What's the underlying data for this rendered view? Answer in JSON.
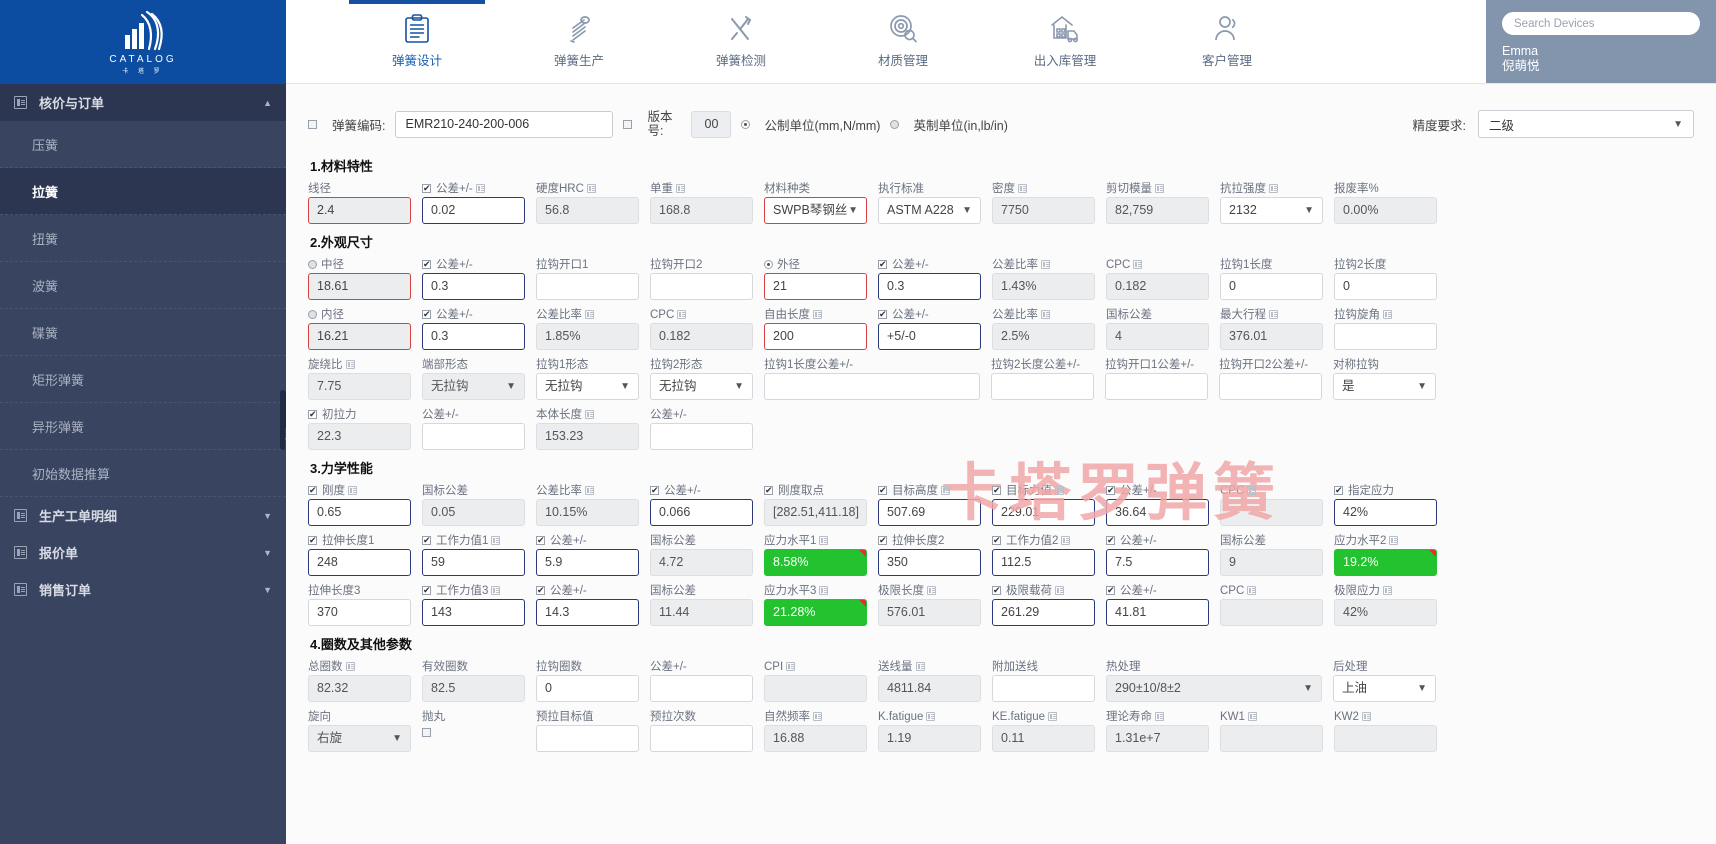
{
  "brand": {
    "name": "CATALOG",
    "sub": "卡 塔 罗"
  },
  "sidebar": {
    "groups": [
      {
        "label": "核价与订单",
        "expanded": true,
        "items": [
          "压簧",
          "拉簧",
          "扭簧",
          "波簧",
          "碟簧",
          "矩形弹簧",
          "异形弹簧",
          "初始数据推算"
        ],
        "active": "拉簧"
      },
      {
        "label": "生产工单明细",
        "expanded": false,
        "items": []
      },
      {
        "label": "报价单",
        "expanded": false,
        "items": []
      },
      {
        "label": "销售订单",
        "expanded": false,
        "items": []
      }
    ]
  },
  "topnav": {
    "tabs": [
      {
        "label": "弹簧设计",
        "icon": "clipboard-icon",
        "active": true
      },
      {
        "label": "弹簧生产",
        "icon": "spring-icon",
        "active": false
      },
      {
        "label": "弹簧检测",
        "icon": "tools-icon",
        "active": false
      },
      {
        "label": "材质管理",
        "icon": "target-search-icon",
        "active": false
      },
      {
        "label": "出入库管理",
        "icon": "warehouse-truck-icon",
        "active": false
      },
      {
        "label": "客户管理",
        "icon": "users-icon",
        "active": false
      }
    ],
    "search_placeholder": "Search Devices",
    "user": {
      "name_en": "Emma",
      "name_cn": "倪萌悦"
    }
  },
  "header": {
    "code_label": "弹簧编码:",
    "code_value": "EMR210-240-200-006",
    "version_label": "版本号:",
    "version_value": "00",
    "unit_metric": "公制单位(mm,N/mm)",
    "unit_imperial": "英制单位(in,lb/in)",
    "precision_label": "精度要求:",
    "precision_value": "二级"
  },
  "watermark": "卡塔罗弹簧",
  "sections": [
    {
      "title": "1.材料特性",
      "rows": [
        [
          {
            "label": "线径",
            "value": "2.4",
            "style": "red"
          },
          {
            "label": "公差+/-",
            "value": "0.02",
            "style": "blue",
            "checkbox": true,
            "mini": true
          },
          {
            "label": "硬度HRC",
            "value": "56.8",
            "style": "ro",
            "mini": true
          },
          {
            "label": "单重",
            "value": "168.8",
            "style": "ro",
            "mini": true
          },
          {
            "label": "材料种类",
            "value": "SWPB琴钢丝",
            "style": "redw",
            "select": true
          },
          {
            "label": "执行标准",
            "value": "ASTM A228",
            "style": "",
            "select": true
          },
          {
            "label": "密度",
            "value": "7750",
            "style": "ro",
            "mini": true
          },
          {
            "label": "剪切模量",
            "value": "82,759",
            "style": "ro",
            "mini": true
          },
          {
            "label": "抗拉强度",
            "value": "2132",
            "style": "",
            "select": true,
            "mini": true
          },
          {
            "label": "报废率%",
            "value": "0.00%",
            "style": "ro"
          }
        ]
      ]
    },
    {
      "title": "2.外观尺寸",
      "rows": [
        [
          {
            "label": "中径",
            "value": "18.61",
            "style": "red",
            "radio": true
          },
          {
            "label": "公差+/-",
            "value": "0.3",
            "style": "blue",
            "checkbox": true
          },
          {
            "label": "拉钩开口1",
            "value": "",
            "style": ""
          },
          {
            "label": "拉钩开口2",
            "value": "",
            "style": ""
          },
          {
            "label": "外径",
            "value": "21",
            "style": "redw",
            "radio": true,
            "radio_on": true
          },
          {
            "label": "公差+/-",
            "value": "0.3",
            "style": "blue",
            "checkbox": true
          },
          {
            "label": "公差比率",
            "value": "1.43%",
            "style": "ro",
            "mini": true
          },
          {
            "label": "CPC",
            "value": "0.182",
            "style": "ro",
            "mini": true
          },
          {
            "label": "拉钩1长度",
            "value": "0",
            "style": ""
          },
          {
            "label": "拉钩2长度",
            "value": "0",
            "style": ""
          }
        ],
        [
          {
            "label": "内径",
            "value": "16.21",
            "style": "red",
            "radio": true
          },
          {
            "label": "公差+/-",
            "value": "0.3",
            "style": "blue",
            "checkbox": true
          },
          {
            "label": "公差比率",
            "value": "1.85%",
            "style": "ro",
            "mini": true
          },
          {
            "label": "CPC",
            "value": "0.182",
            "style": "ro",
            "mini": true
          },
          {
            "label": "自由长度",
            "value": "200",
            "style": "redw",
            "mini": true
          },
          {
            "label": "公差+/-",
            "value": "+5/-0",
            "style": "blue",
            "checkbox": true
          },
          {
            "label": "公差比率",
            "value": "2.5%",
            "style": "ro",
            "mini": true
          },
          {
            "label": "国标公差",
            "value": "4",
            "style": "ro"
          },
          {
            "label": "最大行程",
            "value": "376.01",
            "style": "ro",
            "mini": true
          },
          {
            "label": "拉钩旋角",
            "value": "",
            "style": "",
            "mini": true
          }
        ],
        [
          {
            "label": "旋绕比",
            "value": "7.75",
            "style": "ro",
            "mini": true
          },
          {
            "label": "端部形态",
            "value": "无拉钩",
            "style": "ro",
            "select": true
          },
          {
            "label": "拉钩1形态",
            "value": "无拉钩",
            "style": "",
            "select": true
          },
          {
            "label": "拉钩2形态",
            "value": "无拉钩",
            "style": "",
            "select": true
          },
          {
            "label": "拉钩1长度公差+/-",
            "value": "",
            "style": "",
            "wide": true
          },
          {
            "label": "拉钩2长度公差+/-",
            "value": "",
            "style": ""
          },
          {
            "label": "拉钩开口1公差+/-",
            "value": "",
            "style": ""
          },
          {
            "label": "拉钩开口2公差+/-",
            "value": "",
            "style": ""
          },
          {
            "label": "对称拉钩",
            "value": "是",
            "style": "",
            "select": true
          },
          {
            "label": "",
            "value": "",
            "style": "none"
          }
        ],
        [
          {
            "label": "初拉力",
            "value": "22.3",
            "style": "ro",
            "checkbox": true
          },
          {
            "label": "公差+/-",
            "value": "",
            "style": ""
          },
          {
            "label": "本体长度",
            "value": "153.23",
            "style": "ro",
            "mini": true
          },
          {
            "label": "公差+/-",
            "value": "",
            "style": ""
          },
          {
            "label": "",
            "value": "",
            "style": "none"
          },
          {
            "label": "",
            "value": "",
            "style": "none"
          },
          {
            "label": "",
            "value": "",
            "style": "none"
          },
          {
            "label": "",
            "value": "",
            "style": "none"
          },
          {
            "label": "",
            "value": "",
            "style": "none"
          },
          {
            "label": "",
            "value": "",
            "style": "none"
          }
        ]
      ]
    },
    {
      "title": "3.力学性能",
      "rows": [
        [
          {
            "label": "刚度",
            "value": "0.65",
            "style": "blue",
            "checkbox": true,
            "mini": true
          },
          {
            "label": "国标公差",
            "value": "0.05",
            "style": "ro"
          },
          {
            "label": "公差比率",
            "value": "10.15%",
            "style": "ro",
            "mini": true
          },
          {
            "label": "公差+/-",
            "value": "0.066",
            "style": "blue",
            "checkbox": true
          },
          {
            "label": "刚度取点",
            "value": "[282.51,411.18]",
            "style": "ro",
            "checkbox": true
          },
          {
            "label": "目标高度",
            "value": "507.69",
            "style": "blue",
            "checkbox": true,
            "mini": true
          },
          {
            "label": "目标力值",
            "value": "229.01",
            "style": "blue",
            "checkbox": true,
            "mini": true
          },
          {
            "label": "公差+/-",
            "value": "36.64",
            "style": "blue",
            "checkbox": true
          },
          {
            "label": "CPC",
            "value": "",
            "style": "ro",
            "mini": true
          },
          {
            "label": "指定应力",
            "value": "42%",
            "style": "blue",
            "checkbox": true
          }
        ],
        [
          {
            "label": "拉伸长度1",
            "value": "248",
            "style": "blue",
            "checkbox": true
          },
          {
            "label": "工作力值1",
            "value": "59",
            "style": "blue",
            "checkbox": true,
            "mini": true
          },
          {
            "label": "公差+/-",
            "value": "5.9",
            "style": "blue",
            "checkbox": true
          },
          {
            "label": "国标公差",
            "value": "4.72",
            "style": "ro"
          },
          {
            "label": "应力水平1",
            "value": "8.58%",
            "style": "green",
            "mini": true
          },
          {
            "label": "拉伸长度2",
            "value": "350",
            "style": "blue",
            "checkbox": true
          },
          {
            "label": "工作力值2",
            "value": "112.5",
            "style": "blue",
            "checkbox": true,
            "mini": true
          },
          {
            "label": "公差+/-",
            "value": "7.5",
            "style": "blue",
            "checkbox": true
          },
          {
            "label": "国标公差",
            "value": "9",
            "style": "ro"
          },
          {
            "label": "应力水平2",
            "value": "19.2%",
            "style": "green",
            "mini": true
          }
        ],
        [
          {
            "label": "拉伸长度3",
            "value": "370",
            "style": ""
          },
          {
            "label": "工作力值3",
            "value": "143",
            "style": "blue",
            "checkbox": true,
            "mini": true
          },
          {
            "label": "公差+/-",
            "value": "14.3",
            "style": "blue",
            "checkbox": true
          },
          {
            "label": "国标公差",
            "value": "11.44",
            "style": "ro"
          },
          {
            "label": "应力水平3",
            "value": "21.28%",
            "style": "green",
            "mini": true
          },
          {
            "label": "极限长度",
            "value": "576.01",
            "style": "ro",
            "mini": true
          },
          {
            "label": "极限载荷",
            "value": "261.29",
            "style": "blue",
            "checkbox": true,
            "mini": true
          },
          {
            "label": "公差+/-",
            "value": "41.81",
            "style": "blue",
            "checkbox": true
          },
          {
            "label": "CPC",
            "value": "",
            "style": "ro",
            "mini": true
          },
          {
            "label": "极限应力",
            "value": "42%",
            "style": "ro",
            "mini": true
          }
        ]
      ]
    },
    {
      "title": "4.圈数及其他参数",
      "rows": [
        [
          {
            "label": "总圈数",
            "value": "82.32",
            "style": "ro",
            "mini": true
          },
          {
            "label": "有效圈数",
            "value": "82.5",
            "style": "ro"
          },
          {
            "label": "拉钩圈数",
            "value": "0",
            "style": ""
          },
          {
            "label": "公差+/-",
            "value": "",
            "style": ""
          },
          {
            "label": "CPI",
            "value": "",
            "style": "ro",
            "mini": true
          },
          {
            "label": "送线量",
            "value": "4811.84",
            "style": "ro",
            "mini": true
          },
          {
            "label": "附加送线",
            "value": "",
            "style": ""
          },
          {
            "label": "热处理",
            "value": "290±10/8±2",
            "style": "ro",
            "select": true,
            "wide2": true
          },
          {
            "label": "后处理",
            "value": "上油",
            "style": "",
            "select": true
          }
        ],
        [
          {
            "label": "旋向",
            "value": "右旋",
            "style": "ro",
            "select": true
          },
          {
            "label": "抛丸",
            "value": "",
            "style": "checkonly"
          },
          {
            "label": "预拉目标值",
            "value": "",
            "style": ""
          },
          {
            "label": "预拉次数",
            "value": "",
            "style": ""
          },
          {
            "label": "自然频率",
            "value": "16.88",
            "style": "ro",
            "mini": true
          },
          {
            "label": "K.fatigue",
            "value": "1.19",
            "style": "ro",
            "mini": true
          },
          {
            "label": "KE.fatigue",
            "value": "0.11",
            "style": "ro",
            "mini": true
          },
          {
            "label": "理论寿命",
            "value": "1.31e+7",
            "style": "ro",
            "mini": true
          },
          {
            "label": "KW1",
            "value": "",
            "style": "ro",
            "mini": true
          },
          {
            "label": "KW2",
            "value": "",
            "style": "ro",
            "mini": true
          }
        ]
      ]
    }
  ]
}
